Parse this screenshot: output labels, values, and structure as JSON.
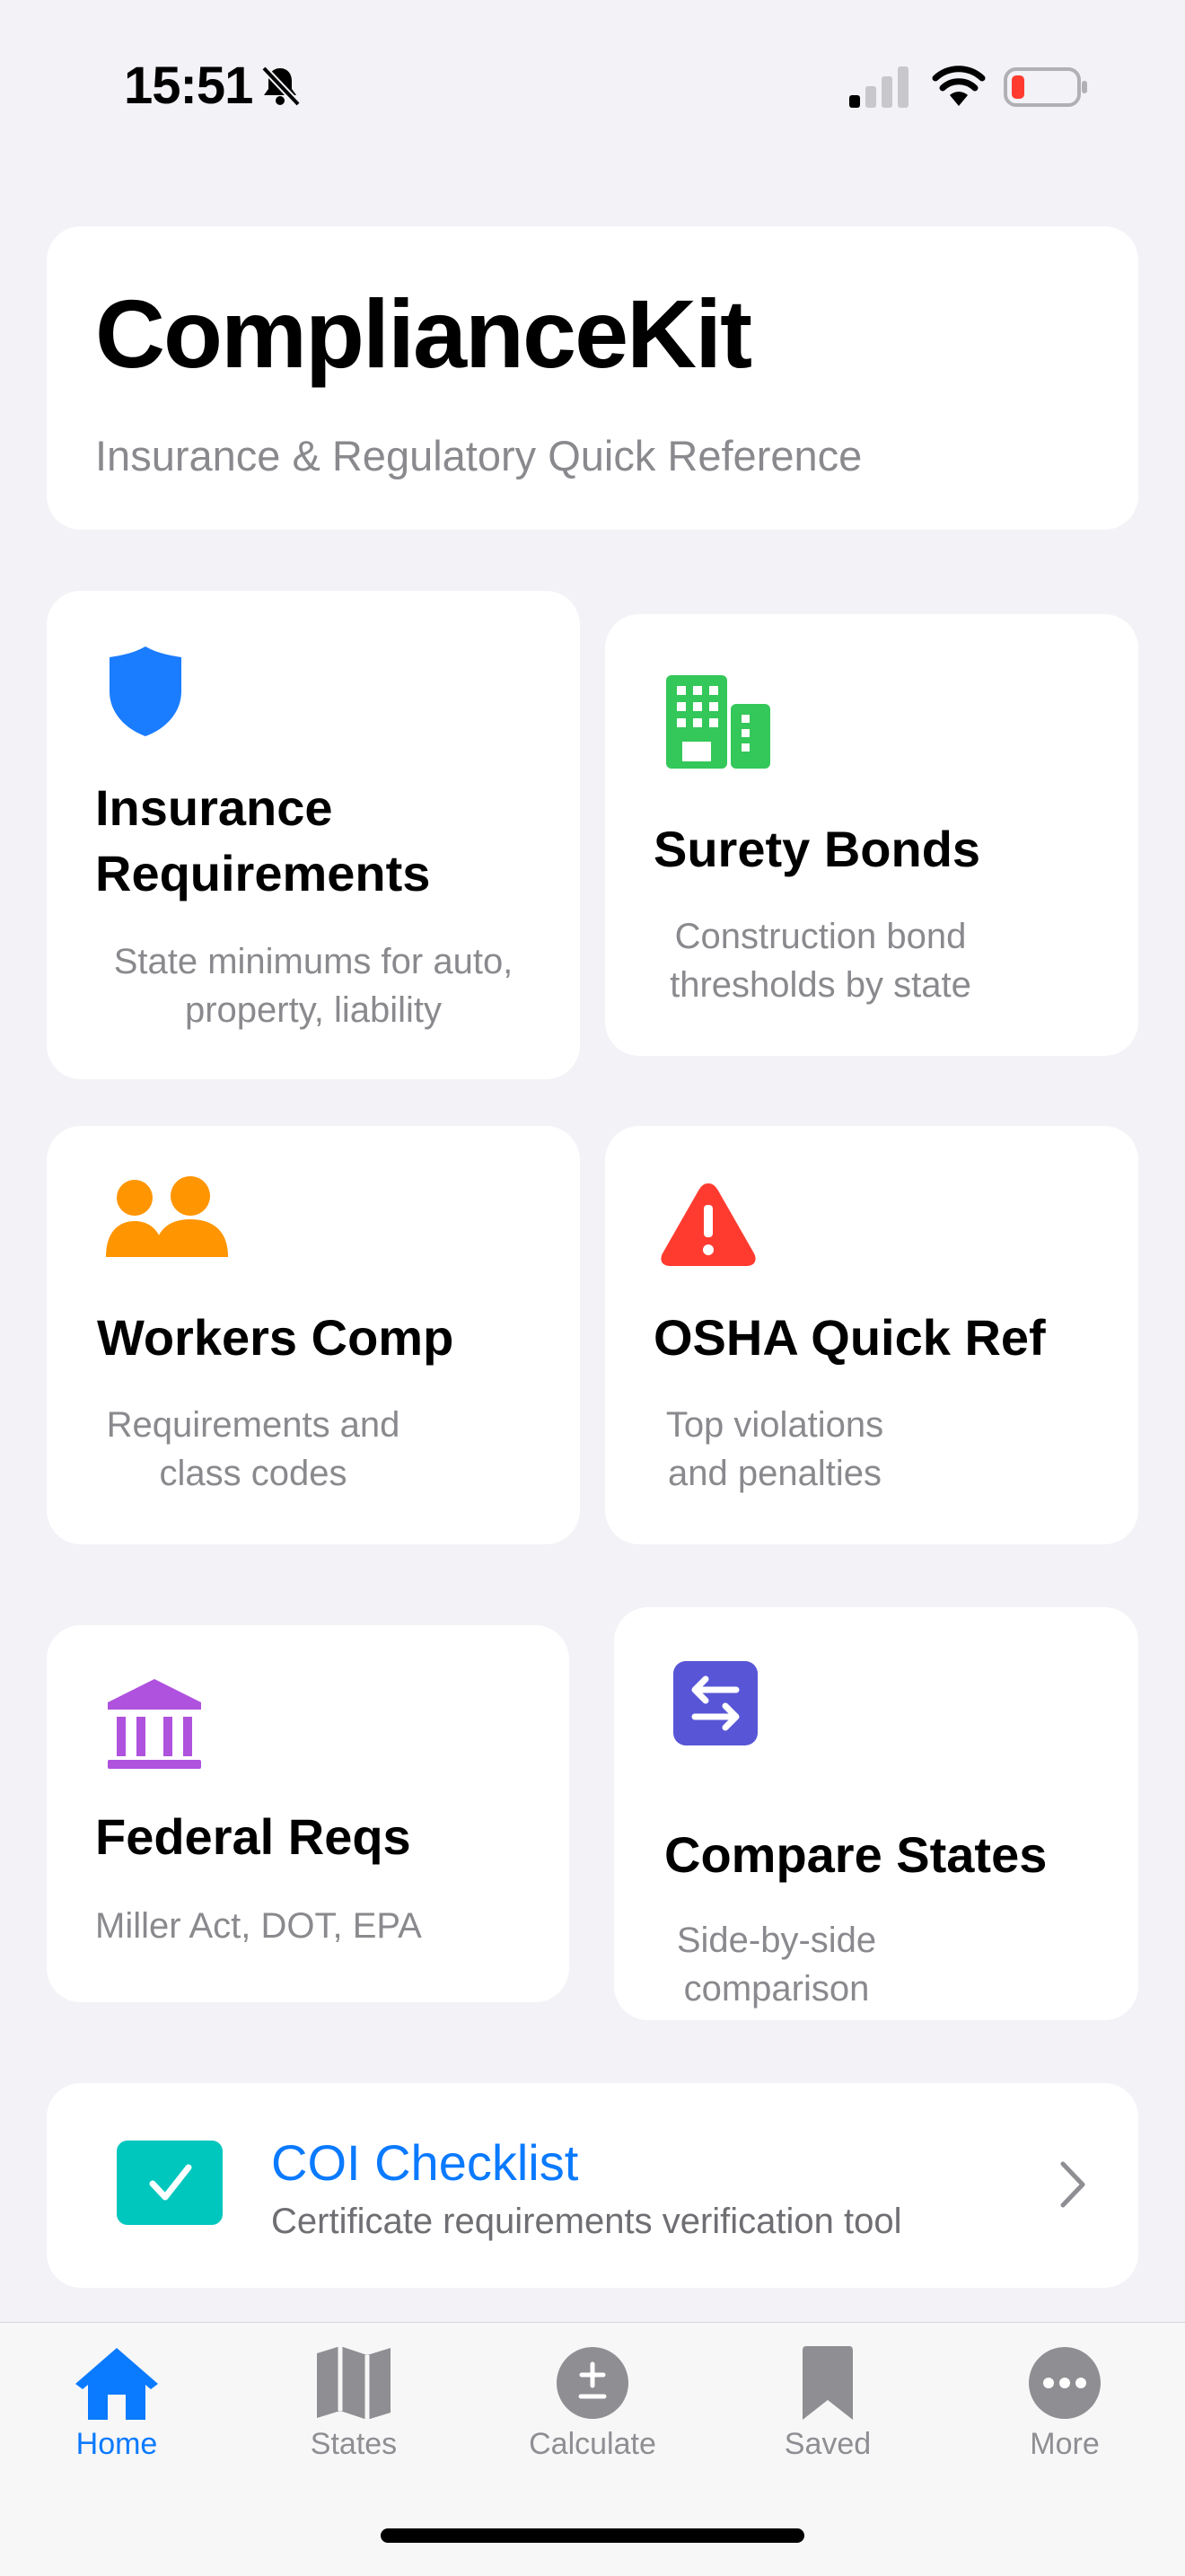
{
  "status_bar": {
    "time": "15:51",
    "icons": [
      "bell-slash-icon",
      "cellular-signal-icon",
      "wifi-icon",
      "battery-low-icon"
    ]
  },
  "header": {
    "title": "ComplianceKit",
    "subtitle": "Insurance & Regulatory Quick Reference"
  },
  "tiles": [
    {
      "icon": "shield-icon",
      "color": "#1a7cff",
      "title": "Insurance Requirements",
      "title_lines": [
        "Insurance",
        "Requirements"
      ],
      "desc_lines": [
        "State minimums for auto,",
        "property, liability"
      ]
    },
    {
      "icon": "building-icon",
      "color": "#34c759",
      "title": "Surety Bonds",
      "desc_lines": [
        "Construction bond",
        "thresholds by state"
      ]
    },
    {
      "icon": "people-icon",
      "color": "#ff9500",
      "title": "Workers Comp",
      "desc_lines": [
        "Requirements and",
        "class codes"
      ]
    },
    {
      "icon": "warning-icon",
      "color": "#ff3b30",
      "title": "OSHA Quick Ref",
      "desc_lines": [
        "Top violations",
        "and penalties"
      ]
    },
    {
      "icon": "bank-icon",
      "color": "#af52de",
      "title": "Federal Reqs",
      "desc_lines": [
        "Miller Act, DOT, EPA"
      ]
    },
    {
      "icon": "swap-arrows-icon",
      "color": "#5856d6",
      "title": "Compare States",
      "desc_lines": [
        "Side-by-side",
        "comparison"
      ]
    }
  ],
  "coi": {
    "icon": "checkmark-square-icon",
    "icon_color": "#00c7be",
    "title": "COI Checklist",
    "subtitle": "Certificate requirements verification tool",
    "title_color": "#0a7aff"
  },
  "tabbar": {
    "tabs": [
      {
        "label": "Home",
        "icon": "house-icon",
        "active": true
      },
      {
        "label": "States",
        "icon": "map-icon",
        "active": false
      },
      {
        "label": "Calculate",
        "icon": "plus-minus-icon",
        "active": false
      },
      {
        "label": "Saved",
        "icon": "bookmark-icon",
        "active": false
      },
      {
        "label": "More",
        "icon": "ellipsis-circle-icon",
        "active": false
      }
    ],
    "active_color": "#0a7aff",
    "inactive_color": "#8e8e93"
  }
}
